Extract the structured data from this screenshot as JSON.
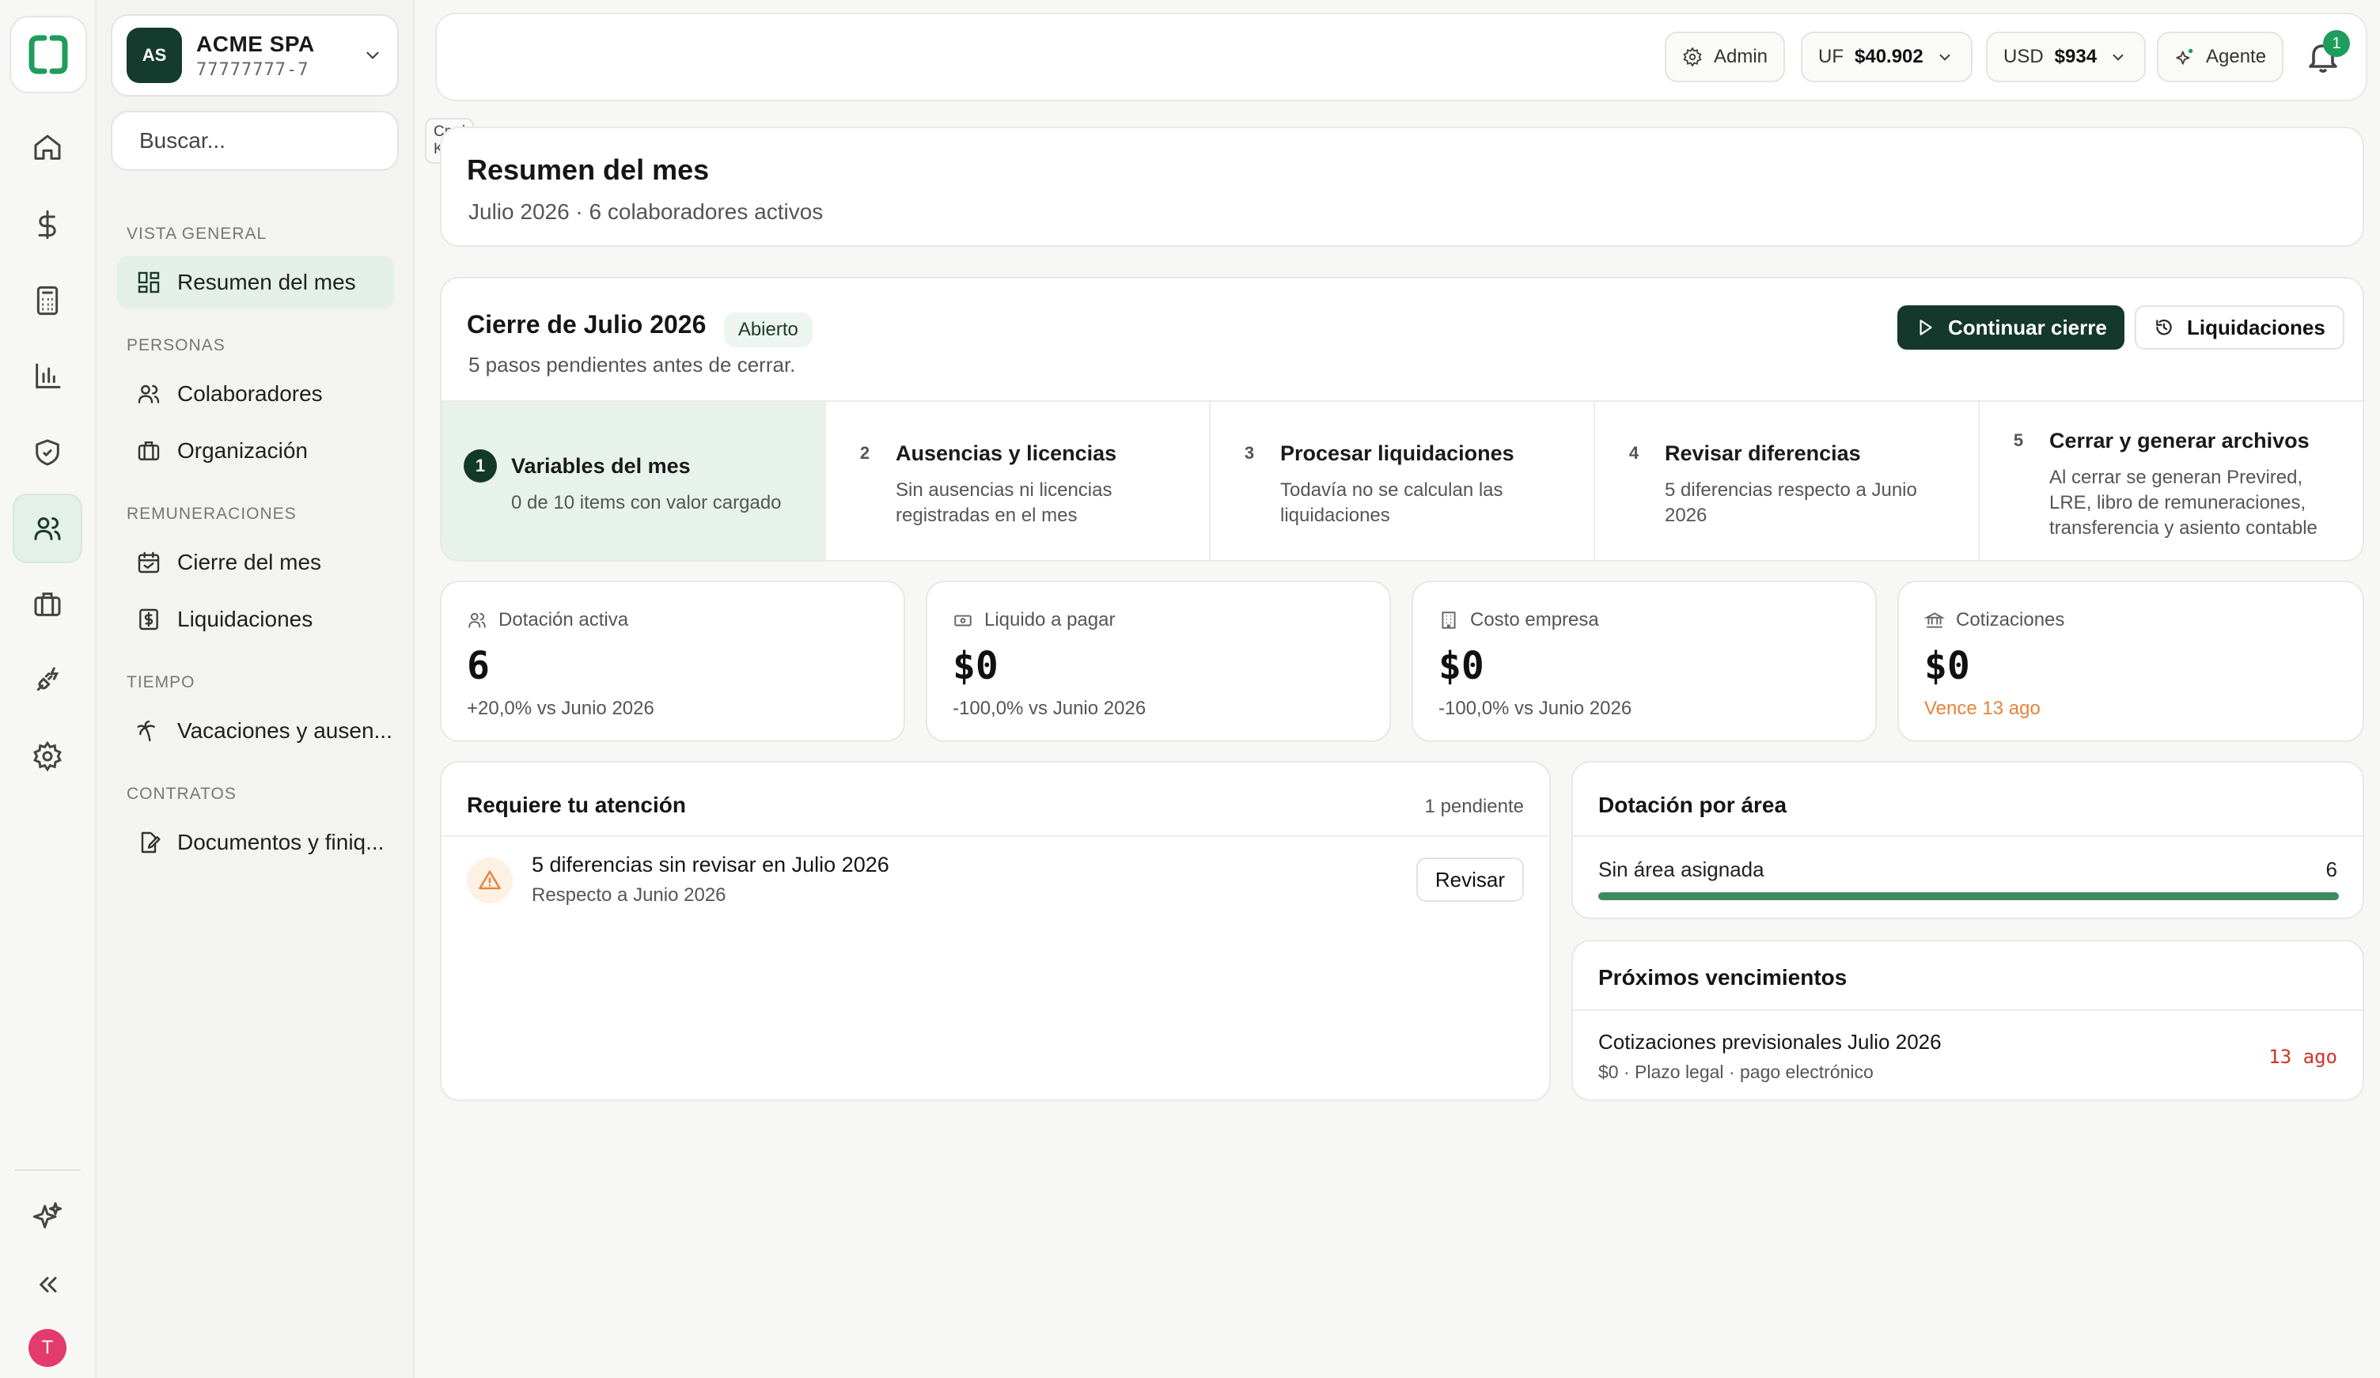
{
  "rail": {
    "items": [
      "home-icon",
      "dollar-icon",
      "calculator-icon",
      "chart-icon",
      "shield-icon",
      "users-icon",
      "briefcase-icon",
      "plug-icon",
      "gear-icon"
    ],
    "active": "users-icon",
    "avatar_initial": "T"
  },
  "company": {
    "initials": "AS",
    "name": "ACME SPA",
    "rut": "77777777-7"
  },
  "search": {
    "placeholder": "Buscar...",
    "shortcut": "Cmd K"
  },
  "nav": {
    "sections": [
      {
        "title": "VISTA GENERAL",
        "items": [
          {
            "label": "Resumen del mes",
            "icon": "grid-icon",
            "active": true
          }
        ]
      },
      {
        "title": "PERSONAS",
        "items": [
          {
            "label": "Colaboradores",
            "icon": "users-icon"
          },
          {
            "label": "Organización",
            "icon": "building-icon"
          }
        ]
      },
      {
        "title": "REMUNERACIONES",
        "items": [
          {
            "label": "Cierre del mes",
            "icon": "calendar-icon"
          },
          {
            "label": "Liquidaciones",
            "icon": "receipt-icon"
          }
        ]
      },
      {
        "title": "TIEMPO",
        "items": [
          {
            "label": "Vacaciones y ausen...",
            "icon": "palm-icon"
          }
        ]
      },
      {
        "title": "CONTRATOS",
        "items": [
          {
            "label": "Documentos y finiq...",
            "icon": "document-icon"
          }
        ]
      }
    ]
  },
  "topbar": {
    "admin_label": "Admin",
    "uf_label": "UF",
    "uf_value": "$40.902",
    "usd_label": "USD",
    "usd_value": "$934",
    "agent_label": "Agente",
    "notifications_count": "1"
  },
  "summary": {
    "title": "Resumen del mes",
    "subtitle": "Julio 2026 · 6 colaboradores activos"
  },
  "closing": {
    "title": "Cierre de Julio 2026",
    "status": "Abierto",
    "subtitle": "5 pasos pendientes antes de cerrar.",
    "continue_label": "Continuar cierre",
    "payslips_label": "Liquidaciones",
    "steps": [
      {
        "num": "1",
        "title": "Variables del mes",
        "desc": "0 de 10 items con valor cargado"
      },
      {
        "num": "2",
        "title": "Ausencias y licencias",
        "desc": "Sin ausencias ni licencias registradas en el mes"
      },
      {
        "num": "3",
        "title": "Procesar liquidaciones",
        "desc": "Todavía no se calculan las liquidaciones"
      },
      {
        "num": "4",
        "title": "Revisar diferencias",
        "desc": "5 diferencias respecto a Junio 2026"
      },
      {
        "num": "5",
        "title": "Cerrar y generar archivos",
        "desc": "Al cerrar se generan Previred, LRE, libro de remuneraciones, transferencia y asiento contable"
      }
    ]
  },
  "kpis": [
    {
      "label": "Dotación activa",
      "icon": "users-icon",
      "value": "6",
      "delta": "+20,0% vs Junio 2026"
    },
    {
      "label": "Liquido a pagar",
      "icon": "cash-icon",
      "value": "$0",
      "delta": "-100,0% vs Junio 2026"
    },
    {
      "label": "Costo empresa",
      "icon": "building-icon",
      "value": "$0",
      "delta": "-100,0% vs Junio 2026"
    },
    {
      "label": "Cotizaciones",
      "icon": "bank-icon",
      "value": "$0",
      "delta": "Vence 13 ago",
      "delta_color": "#e8833a"
    }
  ],
  "attention": {
    "title": "Requiere tu atención",
    "count": "1 pendiente",
    "item_title": "5 diferencias sin revisar en Julio 2026",
    "item_sub": "Respecto a Junio 2026",
    "review_label": "Revisar"
  },
  "area": {
    "title": "Dotación por área",
    "row_label": "Sin área asignada",
    "row_value": "6",
    "row_fraction": 1.0
  },
  "due": {
    "title": "Próximos vencimientos",
    "item_title": "Cotizaciones previsionales Julio 2026",
    "item_sub": "$0 · Plazo legal · pago electrónico",
    "item_date": "13 ago"
  },
  "colors": {
    "brand": "#14382b",
    "accent_green": "#1f9d5c",
    "warning": "#e8833a",
    "danger": "#d0342c"
  }
}
